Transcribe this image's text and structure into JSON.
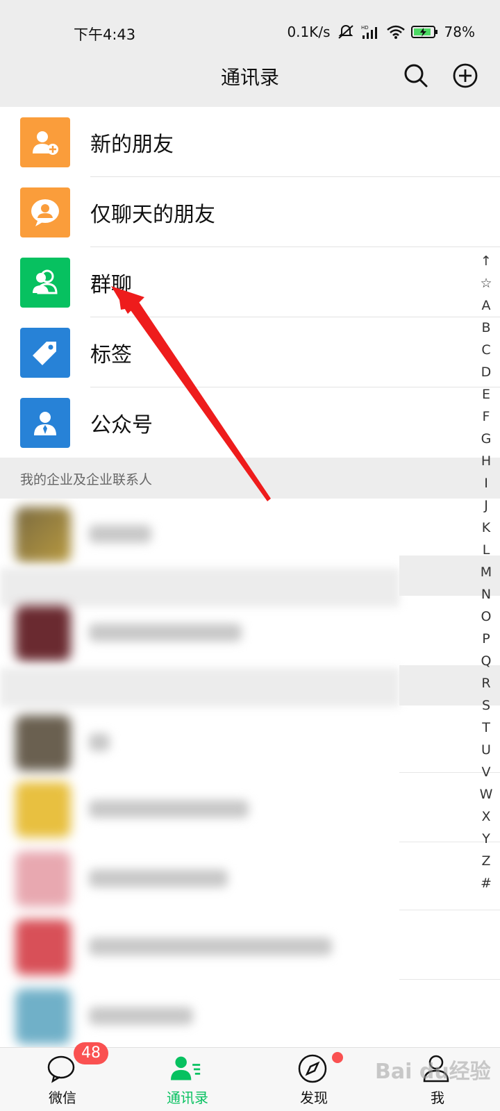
{
  "status_bar": {
    "time": "下午4:43",
    "net_speed": "0.1K/s",
    "battery": "78%"
  },
  "header": {
    "title": "通讯录",
    "search_icon": "search-icon",
    "add_icon": "add-circle-icon"
  },
  "menu": {
    "items": [
      {
        "label": "新的朋友",
        "icon": "add-friend-icon",
        "color": "#fa9d3b"
      },
      {
        "label": "仅聊天的朋友",
        "icon": "chat-only-icon",
        "color": "#fa9d3b"
      },
      {
        "label": "群聊",
        "icon": "group-icon",
        "color": "#07c160"
      },
      {
        "label": "标签",
        "icon": "tag-icon",
        "color": "#2782d7"
      },
      {
        "label": "公众号",
        "icon": "official-account-icon",
        "color": "#2782d7"
      }
    ]
  },
  "section": {
    "title": "我的企业及企业联系人"
  },
  "index_bar": [
    "↑",
    "☆",
    "A",
    "B",
    "C",
    "D",
    "E",
    "F",
    "G",
    "H",
    "I",
    "J",
    "K",
    "L",
    "M",
    "N",
    "O",
    "P",
    "Q",
    "R",
    "S",
    "T",
    "U",
    "V",
    "W",
    "X",
    "Y",
    "Z",
    "#"
  ],
  "tabs": [
    {
      "label": "微信",
      "badge": "48",
      "icon": "chat-icon"
    },
    {
      "label": "通讯录",
      "icon": "contacts-icon",
      "active": true
    },
    {
      "label": "发现",
      "icon": "compass-icon",
      "dot": true
    },
    {
      "label": "我",
      "icon": "profile-icon"
    }
  ],
  "colors": {
    "accent": "#07c160",
    "badge": "#fa5151",
    "arrow": "#ee1c1c"
  },
  "watermark": "Bai du经验"
}
